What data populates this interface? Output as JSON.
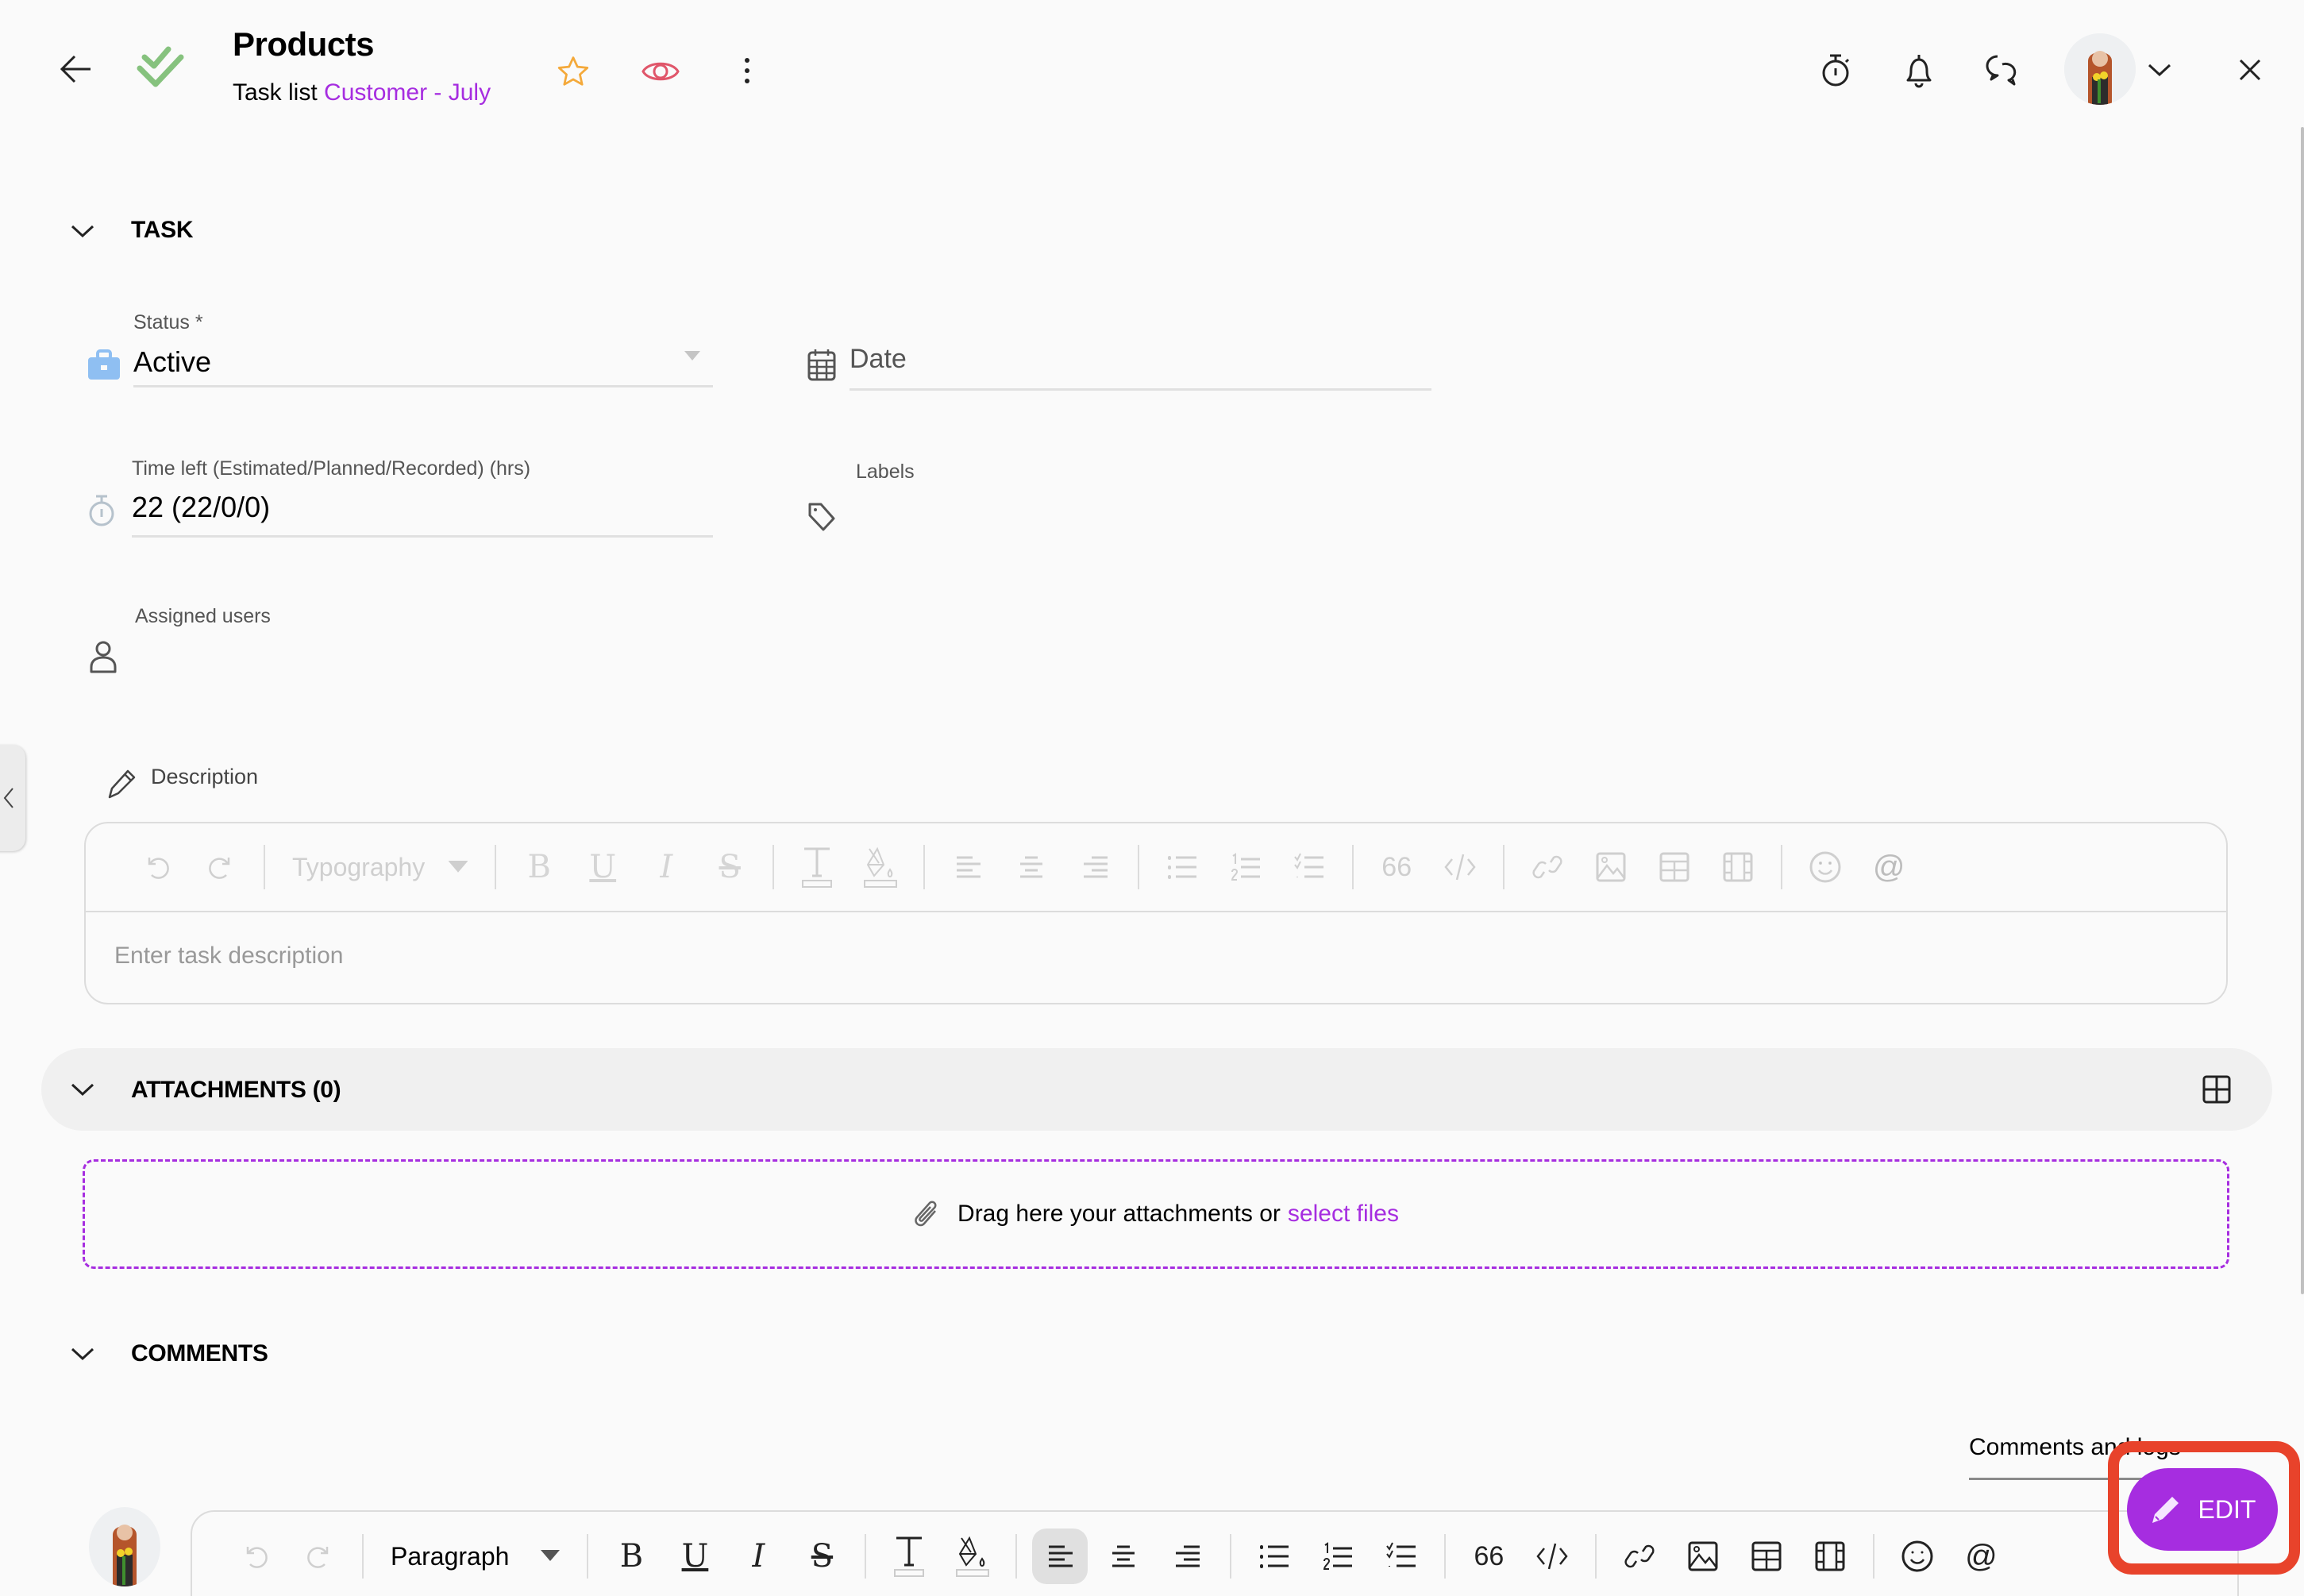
{
  "header": {
    "title": "Products",
    "subtitle_prefix": "Task list",
    "subtitle_link": "Customer - July",
    "icons": [
      "back-arrow-icon",
      "double-check-icon",
      "star-icon",
      "eye-icon",
      "more-vertical-icon",
      "stopwatch-icon",
      "bell-icon",
      "chat-icon",
      "avatar",
      "chevron-down-icon",
      "close-icon"
    ]
  },
  "task": {
    "section_title": "TASK",
    "status_label": "Status *",
    "status_value": "Active",
    "date_placeholder": "Date",
    "time_label": "Time left (Estimated/Planned/Recorded) (hrs)",
    "time_value": "22 (22/0/0)",
    "labels_label": "Labels",
    "assigned_label": "Assigned users",
    "description_label": "Description",
    "description_placeholder": "Enter task description",
    "typography_label": "Typography"
  },
  "attachments": {
    "section_title": "ATTACHMENTS (0)",
    "drop_text": "Drag here your attachments or",
    "select_link": "select files"
  },
  "comments": {
    "section_title": "COMMENTS",
    "filter_label": "Comments and logs",
    "paragraph_label": "Paragraph",
    "quote_label": "66"
  },
  "edit_button": {
    "label": "EDIT"
  },
  "colors": {
    "accent": "#a62de0",
    "check_green": "#86c27e",
    "star": "#f4a93a",
    "eye": "#e0566a",
    "status_icon": "#8fbff2",
    "highlight": "#e8432b"
  }
}
